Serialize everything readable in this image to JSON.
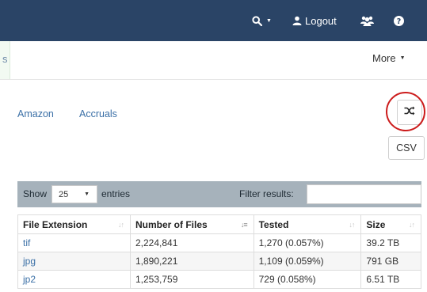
{
  "topbar": {
    "search_label": "",
    "logout_label": "Logout",
    "icons": [
      "search-icon",
      "user-icon",
      "users-icon",
      "help-icon"
    ]
  },
  "subnav": {
    "partial_tab": "s",
    "more_label": "More"
  },
  "links": [
    "Amazon",
    "Accruals"
  ],
  "toolbar": {
    "shuffle_icon": "shuffle-icon",
    "csv_label": "CSV"
  },
  "table_controls": {
    "show_label": "Show",
    "entries_value": "25",
    "entries_label": "entries",
    "filter_label": "Filter results:",
    "filter_value": ""
  },
  "table": {
    "headers": [
      "File Extension",
      "Number of Files",
      "Tested",
      "Size"
    ],
    "rows": [
      [
        "tif",
        "2,224,841",
        "1,270 (0.057%)",
        "39.2 TB"
      ],
      [
        "jpg",
        "1,890,221",
        "1,109 (0.059%)",
        "791 GB"
      ],
      [
        "jp2",
        "1,253,759",
        "729 (0.058%)",
        "6.51 TB"
      ]
    ]
  },
  "colors": {
    "topbar_bg": "#2a4466",
    "link": "#3a6fa6",
    "controls_bg": "#a6b2bb",
    "highlight_circle": "#cc1c1c"
  }
}
